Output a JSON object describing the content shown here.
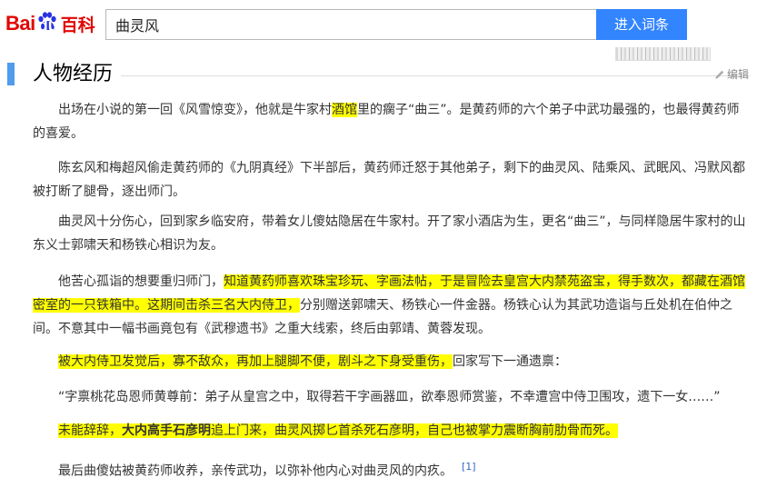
{
  "header": {
    "logo": {
      "part1": "Bai",
      "part2": "du",
      "part3": "百科"
    },
    "search_value": "曲灵风",
    "search_button": "进入词条"
  },
  "section": {
    "title": "人物经历",
    "edit_label": "编辑"
  },
  "paragraphs": [
    [
      {
        "t": "出场在小说的第一回《风雪惊变》，他就是牛家村"
      },
      {
        "t": "酒馆",
        "hl": true
      },
      {
        "t": "里的瘸子“曲三”。是黄药师的六个弟子中武功最强的，也最得黄药师的喜爱。"
      }
    ],
    [
      {
        "t": "陈玄风和梅超风偷走黄药师的《九阴真经》下半部后，黄药师迁怒于其他弟子，剩下的曲灵风、陆乘风、武眠风、冯默风都被打断了腿骨，逐出师门。"
      }
    ],
    [
      {
        "t": "曲灵风十分伤心，回到家乡临安府，带着女儿傻姑隐居在牛家村。开了家小酒店为生，更名“曲三”，与同样隐居牛家村的山东义士郭啸天和杨铁心相识为友。"
      }
    ],
    [
      {
        "t": "他苦心孤诣的想要重归师门，"
      },
      {
        "t": "知道黄药师喜欢珠宝珍玩、字画法帖，于是冒险去皇宫大内禁苑盗宝，得手数次，都藏在酒馆密室的一只铁箱中。这期间击杀三名大内侍卫，",
        "hl": true
      },
      {
        "t": "分别赠送郭啸天、杨铁心一件金器。杨铁心认为其武功造诣与丘处机在伯仲之间。不意其中一幅书画竟包有《武穆遗书》之重大线索，终后由郭靖、黄蓉发现。"
      }
    ],
    [
      {
        "t": "被大内侍卫发觉后，寡不敌众，再加上腿脚不便，剧斗之下身受重伤，",
        "hl": true
      },
      {
        "t": "回家写下一通遗禀："
      }
    ],
    [
      {
        "t": "“字禀桃花岛恩师黄尊前：弟子从皇宫之中，取得若干字画器皿，欲奉恩师赏鉴，不幸遭宫中侍卫围攻，遗下一女……”"
      }
    ],
    [
      {
        "t": "未能辞辞，",
        "hl": true
      },
      {
        "t": "大内高手石彦明",
        "hl": true,
        "b": true
      },
      {
        "t": "追上门来，曲灵风掷匕首杀死石彦明，自己也被掌力震断胸前肋骨而死。",
        "hl": true
      }
    ],
    [
      {
        "t": "最后曲傻姑被黄药师收养，亲传武功，以弥补他内心对曲灵风的内疚。"
      },
      {
        "t": "[1]",
        "ref": true
      }
    ]
  ]
}
